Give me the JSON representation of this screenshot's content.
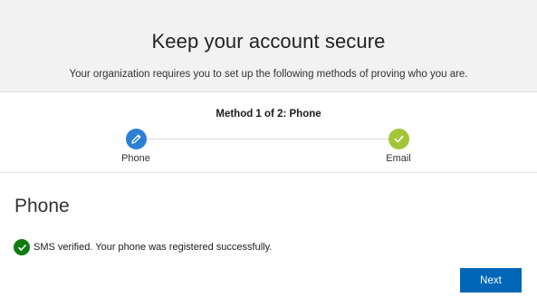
{
  "header": {
    "title": "Keep your account secure",
    "subtitle": "Your organization requires you to set up the following methods of proving who you are."
  },
  "progress": {
    "method_label": "Method 1 of 2: Phone",
    "steps": [
      {
        "label": "Phone",
        "icon": "pencil-icon",
        "color": "#2b7fd4",
        "state": "current"
      },
      {
        "label": "Email",
        "icon": "checkmark-icon",
        "color": "#a3c639",
        "state": "complete"
      }
    ]
  },
  "main": {
    "section_title": "Phone",
    "status_icon": "success-check-icon",
    "status_color": "#107c10",
    "status_message": "SMS verified. Your phone was registered successfully.",
    "next_label": "Next",
    "accent_color": "#0067b8"
  }
}
